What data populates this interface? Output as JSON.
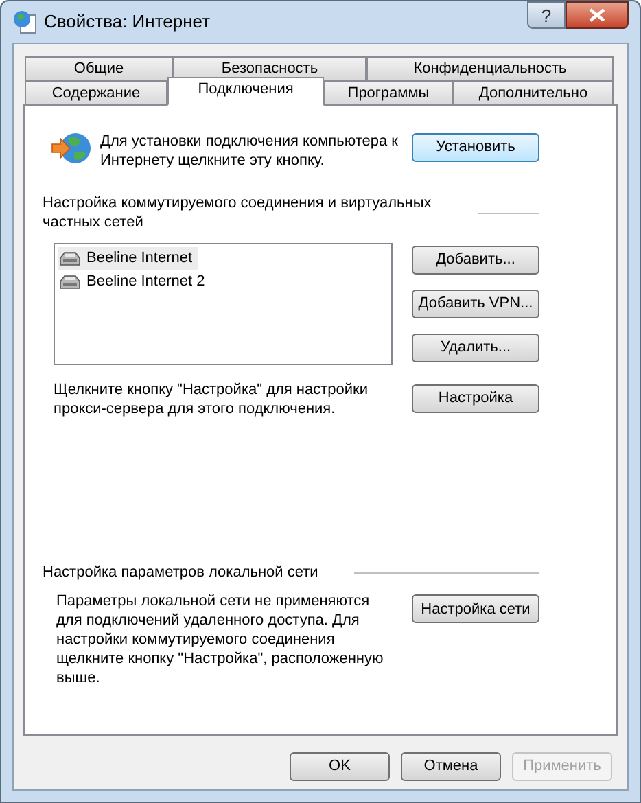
{
  "window": {
    "title": "Свойства: Интернет",
    "help_button": "?"
  },
  "tab_rows": [
    [
      {
        "label": "Общие",
        "selected": false
      },
      {
        "label": "Безопасность",
        "selected": false
      },
      {
        "label": "Конфиденциальность",
        "selected": false
      }
    ],
    [
      {
        "label": "Содержание",
        "selected": false
      },
      {
        "label": "Подключения",
        "selected": true
      },
      {
        "label": "Программы",
        "selected": false
      },
      {
        "label": "Дополнительно",
        "selected": false
      }
    ]
  ],
  "setup": {
    "text": "Для установки подключения компьютера к Интернету щелкните эту кнопку.",
    "button": "Установить"
  },
  "dialup": {
    "label": "Настройка коммутируемого соединения и виртуальных частных сетей",
    "connections": [
      {
        "name": "Beeline Internet",
        "selected": true
      },
      {
        "name": "Beeline Internet 2",
        "selected": false
      }
    ],
    "buttons": [
      "Добавить...",
      "Добавить VPN...",
      "Удалить..."
    ],
    "proxy_text": "Щелкните кнопку \"Настройка\" для настройки прокси-сервера для этого подключения.",
    "settings_button": "Настройка"
  },
  "lan": {
    "label": "Настройка параметров локальной сети",
    "text": "Параметры локальной сети не применяются для подключений удаленного доступа. Для настройки коммутируемого соединения щелкните кнопку \"Настройка\", расположенную выше.",
    "button": "Настройка сети"
  },
  "footer_buttons": [
    {
      "label": "OK",
      "disabled": false
    },
    {
      "label": "Отмена",
      "disabled": false
    },
    {
      "label": "Применить",
      "disabled": true
    }
  ]
}
